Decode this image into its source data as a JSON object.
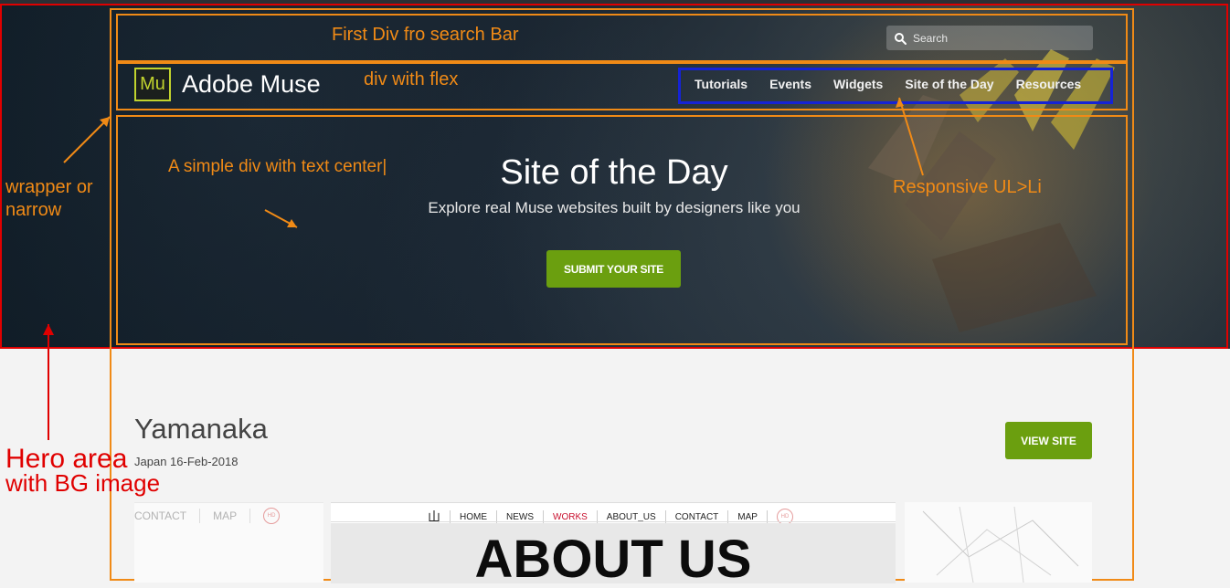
{
  "search": {
    "placeholder": "Search"
  },
  "brand": {
    "logo_text": "Mu",
    "name": "Adobe Muse"
  },
  "nav": {
    "items": [
      "Tutorials",
      "Events",
      "Widgets",
      "Site of the Day",
      "Resources"
    ]
  },
  "hero": {
    "title": "Site of the Day",
    "subtitle": "Explore real Muse websites built by designers like you",
    "button": "SUBMIT YOUR SITE"
  },
  "annotations": {
    "search_bar": "First Div fro search Bar",
    "flex": "div with flex",
    "center": "A simple div with text center|",
    "responsive": "Responsive UL>Li",
    "wrapper_1": "wrapper or",
    "wrapper_2": "narrow",
    "hero_1": "Hero area",
    "hero_2": "with BG image"
  },
  "colors": {
    "accent_green": "#6b9f0f",
    "annotation_orange": "#f08a16",
    "annotation_red": "#e00000",
    "annotation_blue": "#1523d6"
  },
  "site": {
    "title": "Yamanaka",
    "meta": "Japan 16-Feb-2018",
    "button": "VIEW SITE"
  },
  "preview": {
    "left_links": [
      "CONTACT",
      "MAP"
    ],
    "hd": "HD",
    "logo_char": "山",
    "nav": [
      "HOME",
      "NEWS",
      "WORKS",
      "ABOUT_US",
      "CONTACT",
      "MAP"
    ],
    "heading": "ABOUT US"
  }
}
